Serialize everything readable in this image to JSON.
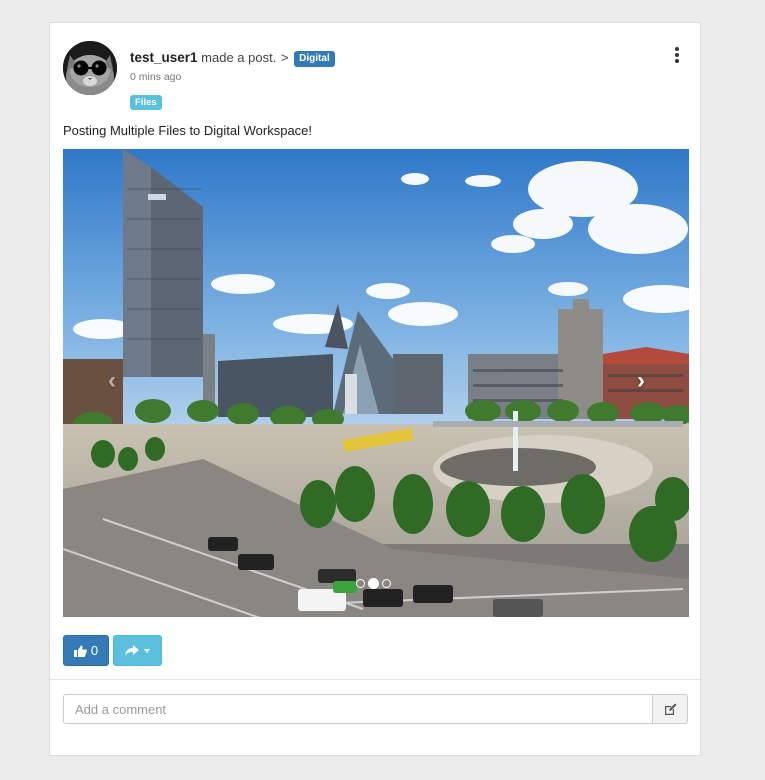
{
  "post": {
    "username": "test_user1",
    "action_text": "made a post.",
    "arrow": ">",
    "space_badge": "Digital",
    "timestamp": "0 mins ago",
    "tag_badge": "Files",
    "text": "Posting Multiple Files to Digital Workspace!",
    "menu_icon": "kebab-menu-icon"
  },
  "carousel": {
    "prev_icon": "chevron-left-icon",
    "next_icon": "chevron-right-icon",
    "prev_glyph": "‹",
    "next_glyph": "›",
    "slide_count": 3,
    "active_slide": 2,
    "image_description_icon": "city-square-photo"
  },
  "actions": {
    "like_count": "0",
    "like_icon": "thumbs-up-icon",
    "share_icon": "share-icon",
    "share_caret_icon": "caret-down-icon"
  },
  "comment": {
    "placeholder": "Add a comment",
    "value": "",
    "submit_icon": "edit-icon"
  },
  "colors": {
    "primary": "#337ab7",
    "info": "#5bc0de",
    "page_bg": "#ececec"
  }
}
